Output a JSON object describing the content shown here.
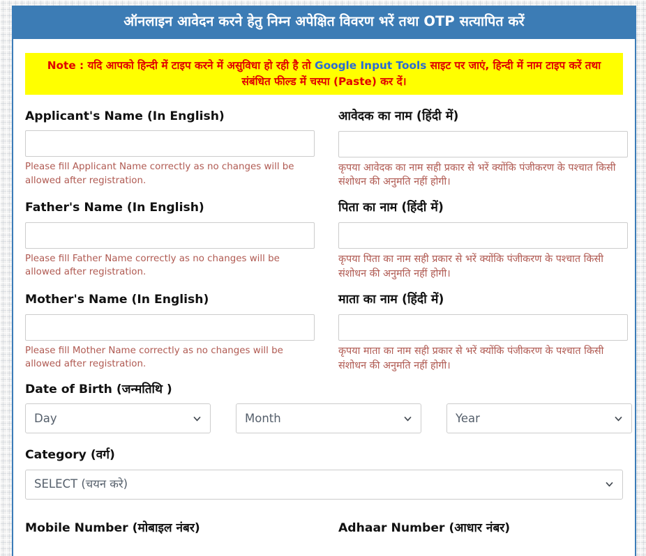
{
  "header": {
    "title": "ऑनलाइन आवेदन करने हेतु निम्न अपेक्षित विवरण भरें तथा OTP सत्यापित करें"
  },
  "note": {
    "prefix": "Note : यदि आपको हिन्दी में टाइप करने में असुविधा हो रही है तो ",
    "link_text": "Google Input Tools",
    "suffix": " साइट पर जाएं, हिन्दी में नाम टाइप करें तथा संबंधित फील्ड में चस्पा (Paste) कर दें।"
  },
  "fields": {
    "applicant_name_en": {
      "label": "Applicant's Name (In English)",
      "value": "",
      "placeholder": "",
      "help": "Please fill Applicant Name correctly as no changes will be allowed after registration."
    },
    "applicant_name_hi": {
      "label": "आवेदक का नाम (हिंदी में)",
      "value": "",
      "placeholder": "",
      "help": "कृपया आवेदक का नाम सही प्रकार से भरें क्योंकि पंजीकरण के पश्चात किसी संशोधन की अनुमति नहीं होगी।"
    },
    "father_name_en": {
      "label": "Father's Name (In English)",
      "value": "",
      "placeholder": "",
      "help": "Please fill Father Name correctly as no changes will be allowed after registration."
    },
    "father_name_hi": {
      "label": "पिता का नाम (हिंदी में)",
      "value": "",
      "placeholder": "",
      "help": "कृपया पिता का नाम सही प्रकार से भरें क्योंकि पंजीकरण के पश्चात किसी संशोधन की अनुमति नहीं होगी।"
    },
    "mother_name_en": {
      "label": "Mother's Name (In English)",
      "value": "",
      "placeholder": "",
      "help": "Please fill Mother Name correctly as no changes will be allowed after registration."
    },
    "mother_name_hi": {
      "label": "माता का नाम (हिंदी में)",
      "value": "",
      "placeholder": "",
      "help": "कृपया माता का नाम सही प्रकार से भरें क्योंकि पंजीकरण के पश्चात किसी संशोधन की अनुमति नहीं होगी।"
    },
    "date_of_birth": {
      "label": "Date of Birth (जन्मतिथि )",
      "day": {
        "selected": "Day"
      },
      "month": {
        "selected": "Month"
      },
      "year": {
        "selected": "Year"
      }
    },
    "category": {
      "label": "Category (वर्ग)",
      "selected": "SELECT (चयन करे)"
    },
    "mobile_number": {
      "label": "Mobile Number (मोबाइल नंबर)"
    },
    "adhaar_number": {
      "label": "Adhaar Number (आधार नंबर)"
    }
  },
  "icons": {
    "chevron_down": "chevron-down-icon"
  },
  "colors": {
    "header_blue": "#3c7cb5",
    "note_background": "#ffff00",
    "note_text": "#e00000",
    "link_blue": "#2b6bd4",
    "help_text": "#b05a52",
    "input_border": "#cccccc",
    "card_border": "#3b7cb8"
  }
}
